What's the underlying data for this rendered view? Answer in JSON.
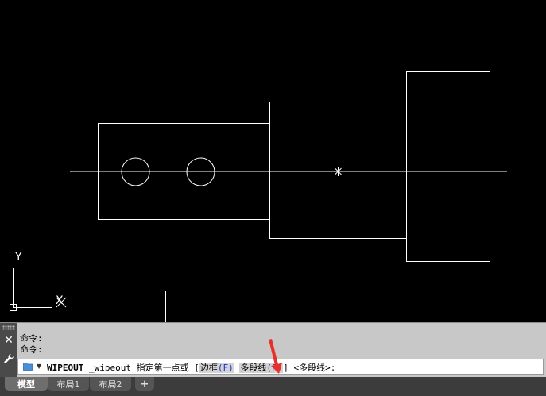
{
  "ucs": {
    "y_label": "Y",
    "x_label": "X"
  },
  "command_line": {
    "history": [
      "命令:",
      "命令:"
    ],
    "prompt": {
      "command": "WIPEOUT",
      "alias": "_wipeout",
      "message": "指定第一点或",
      "open_bracket": "[",
      "options": [
        {
          "name": "边框",
          "key": "(F)"
        },
        {
          "name": "多段线",
          "key": "(P)"
        }
      ],
      "close_bracket": "]",
      "default": "<多段线>:"
    }
  },
  "tabs": [
    "模型",
    "布局1",
    "布局2",
    "+"
  ],
  "colors": {
    "canvas": "#000000",
    "lines": "#ffffff",
    "arrow": "#e8302a",
    "option_key": "#1a2fd0"
  }
}
